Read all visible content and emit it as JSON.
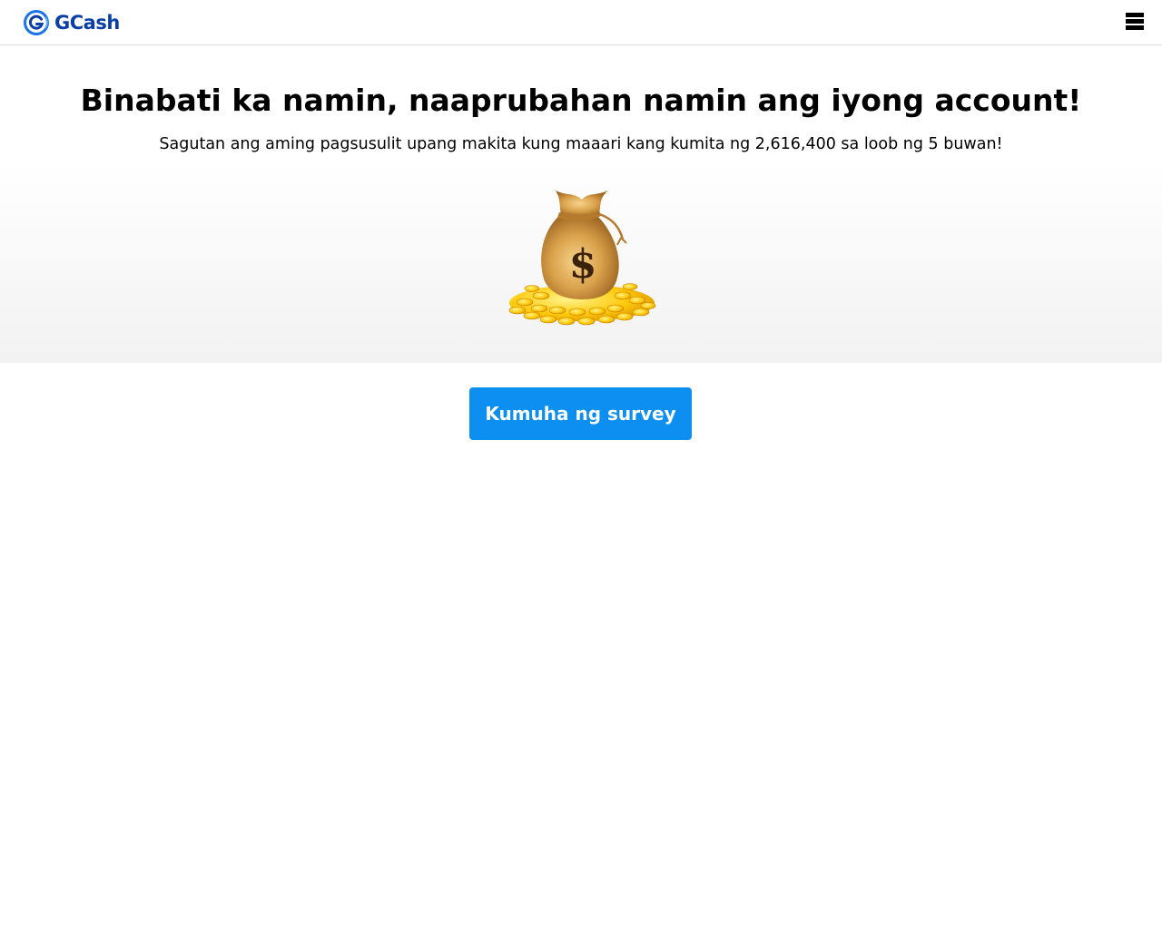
{
  "header": {
    "brand_name": "GCash",
    "brand_color": "#0b3fa8",
    "logo_icon": "gcash-logo-icon",
    "menu_icon": "hamburger-menu-icon"
  },
  "main": {
    "headline": "Binabati ka namin, naaprubahan namin ang iyong account!",
    "subheadline": "Sagutan ang aming pagsusulit upang makita kung maaari kang kumita ng 2,616,400 sa loob ng 5 buwan!",
    "hero_image": "money-bag-with-gold-coins-icon",
    "cta_label": "Kumuha ng survey",
    "cta_color": "#0d8ff2"
  }
}
